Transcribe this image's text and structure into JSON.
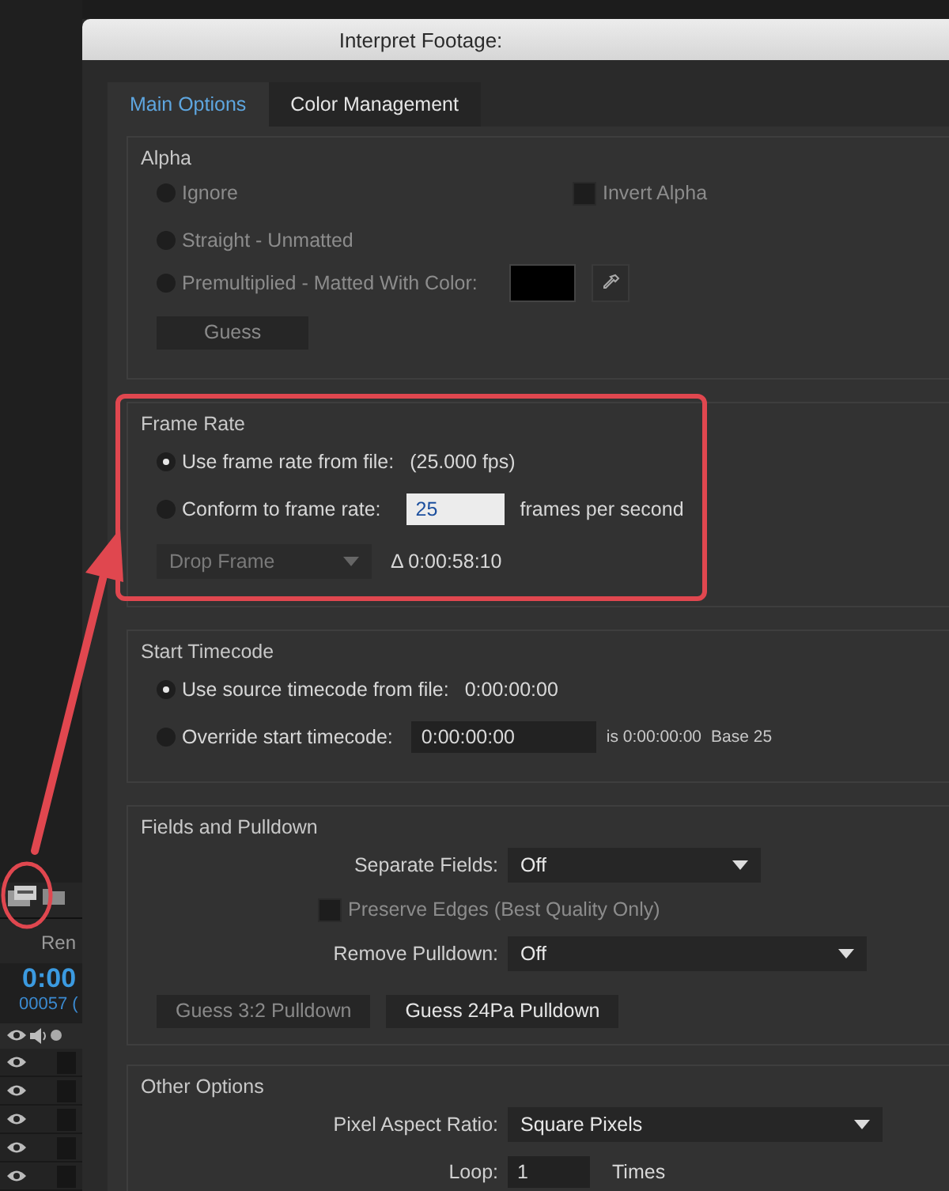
{
  "left_panel": {
    "tab_label": "Ren",
    "timecode": "0:00",
    "frame_count": "00057 (",
    "layers": [
      {
        "visible": true
      },
      {
        "visible": true
      },
      {
        "visible": true
      },
      {
        "visible": true
      },
      {
        "visible": true
      }
    ]
  },
  "dialog": {
    "title": "Interpret Footage:",
    "tabs": [
      {
        "label": "Main Options",
        "selected": true
      },
      {
        "label": "Color Management",
        "selected": false
      }
    ],
    "alpha": {
      "title": "Alpha",
      "options": [
        {
          "label": "Ignore",
          "selected": false,
          "disabled": true
        },
        {
          "label": "Straight - Unmatted",
          "selected": false,
          "disabled": true
        },
        {
          "label": "Premultiplied - Matted With Color:",
          "selected": false,
          "disabled": true
        }
      ],
      "invert": {
        "label": "Invert Alpha",
        "checked": false,
        "disabled": true
      },
      "guess_button": {
        "label": "Guess",
        "disabled": true
      }
    },
    "frame_rate": {
      "title": "Frame Rate",
      "from_file": {
        "label": "Use frame rate from file:",
        "value": "(25.000 fps)",
        "selected": true
      },
      "conform": {
        "label": "Conform to frame rate:",
        "input": "25",
        "suffix": "frames per second",
        "selected": false
      },
      "drop_frame": {
        "value": "Drop Frame",
        "disabled": true
      },
      "delta": "Δ 0:00:58:10"
    },
    "start_timecode": {
      "title": "Start Timecode",
      "from_file": {
        "label": "Use source timecode from file:",
        "value": "0:00:00:00",
        "selected": true
      },
      "override": {
        "label": "Override start timecode:",
        "input": "0:00:00:00",
        "note": "is 0:00:00:00",
        "base": "Base 25",
        "selected": false
      }
    },
    "fields": {
      "title": "Fields and Pulldown",
      "separate": {
        "label": "Separate Fields:",
        "value": "Off"
      },
      "preserve": {
        "label": "Preserve Edges (Best Quality Only)",
        "checked": false,
        "disabled": true
      },
      "remove": {
        "label": "Remove Pulldown:",
        "value": "Off"
      },
      "buttons": [
        {
          "label": "Guess 3:2 Pulldown",
          "disabled": true
        },
        {
          "label": "Guess 24Pa Pulldown",
          "disabled": false
        }
      ]
    },
    "other": {
      "title": "Other Options",
      "pixel_aspect": {
        "label": "Pixel Aspect Ratio:",
        "value": "Square Pixels"
      },
      "loop": {
        "label": "Loop:",
        "value": "1",
        "suffix": "Times"
      }
    }
  }
}
